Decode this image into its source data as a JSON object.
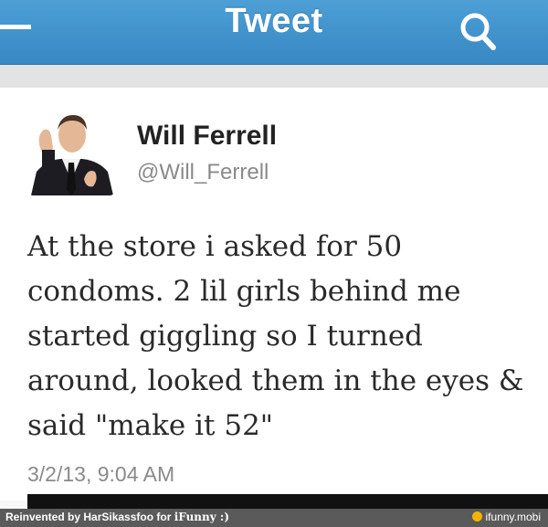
{
  "header": {
    "title": "Tweet",
    "back_icon": "back-dash-icon",
    "search_icon": "search-icon",
    "accent_color": "#3a8bc6"
  },
  "tweet": {
    "author_name": "Will Ferrell",
    "author_handle": "@Will_Ferrell",
    "lines": [
      "At the store i asked for 50",
      "condoms. 2 lil girls behind me",
      "started giggling so I turned",
      "around, looked them in the eyes &",
      "said \"make it 52\""
    ],
    "timestamp": "3/2/13, 9:04 AM"
  },
  "watermark": {
    "left_text": "Reinvented by HarSikassfoo for ",
    "left_brand": "iFunny :)",
    "right_text": "ifunny.mobi"
  }
}
